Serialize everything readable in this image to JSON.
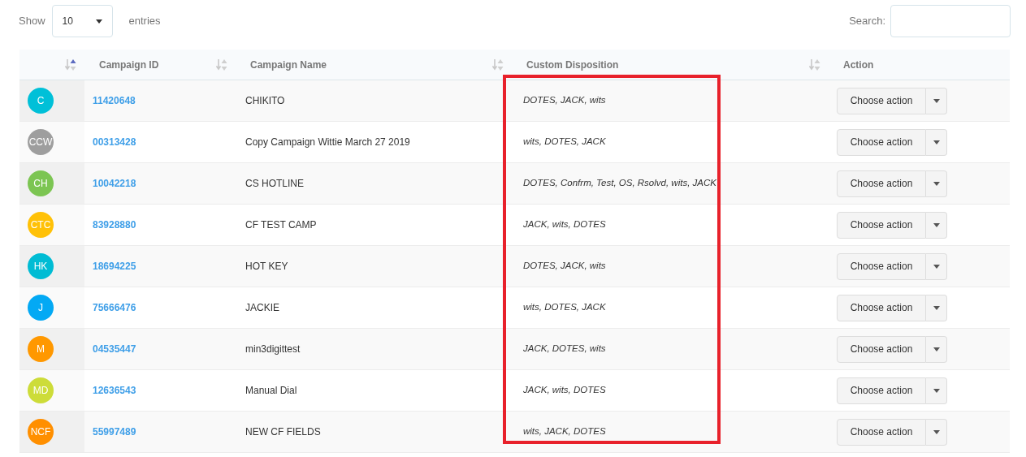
{
  "length_control": {
    "label_before": "Show",
    "value": "10",
    "label_after": "entries"
  },
  "search": {
    "label": "Search:"
  },
  "columns": [
    {
      "sorted": true
    },
    {
      "label": "Campaign ID",
      "sorted": false
    },
    {
      "label": "Campaign Name",
      "sorted": false
    },
    {
      "label": "Custom Disposition",
      "sorted": false
    },
    {
      "label": "Action"
    }
  ],
  "rows": [
    {
      "initials": "C",
      "color": "#00c0d8",
      "id": "11420648",
      "name": "CHIKITO",
      "disposition": "DOTES, JACK, wits",
      "action": "Choose action"
    },
    {
      "initials": "CCW",
      "color": "#9e9e9e",
      "id": "00313428",
      "name": "Copy Campaign Wittie March 27 2019",
      "disposition": "wits, DOTES, JACK",
      "action": "Choose action"
    },
    {
      "initials": "CH",
      "color": "#7cc552",
      "id": "10042218",
      "name": "CS HOTLINE",
      "disposition": "DOTES, Confrm, Test, OS, Rsolvd, wits, JACK",
      "action": "Choose action"
    },
    {
      "initials": "CTC",
      "color": "#ffc107",
      "id": "83928880",
      "name": "CF TEST CAMP",
      "disposition": "JACK, wits, DOTES",
      "action": "Choose action"
    },
    {
      "initials": "HK",
      "color": "#00bcd4",
      "id": "18694225",
      "name": "HOT KEY",
      "disposition": "DOTES, JACK, wits",
      "action": "Choose action"
    },
    {
      "initials": "J",
      "color": "#03a9f4",
      "id": "75666476",
      "name": "JACKIE",
      "disposition": "wits, DOTES, JACK",
      "action": "Choose action"
    },
    {
      "initials": "M",
      "color": "#ff9800",
      "id": "04535447",
      "name": "min3digittest",
      "disposition": "JACK, DOTES, wits",
      "action": "Choose action"
    },
    {
      "initials": "MD",
      "color": "#cddc39",
      "id": "12636543",
      "name": "Manual Dial",
      "disposition": "JACK, wits, DOTES",
      "action": "Choose action"
    },
    {
      "initials": "NCF",
      "color": "#ff8f00",
      "id": "55997489",
      "name": "NEW CF FIELDS",
      "disposition": "wits, JACK, DOTES",
      "action": "Choose action"
    }
  ],
  "highlight": {
    "kind": "frame",
    "color": "#e8212b"
  }
}
